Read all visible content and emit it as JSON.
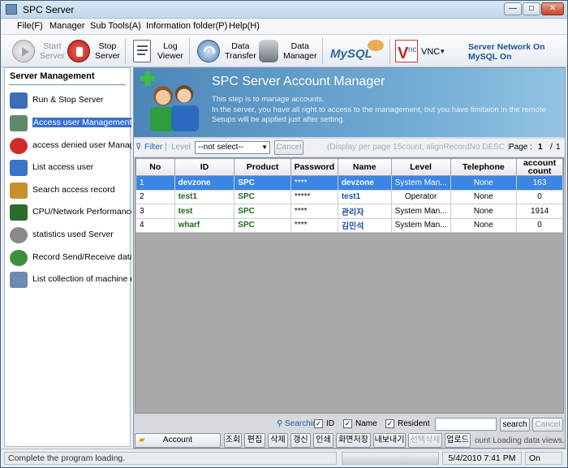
{
  "window": {
    "title": "SPC Server",
    "btn_min": "—",
    "btn_max": "□",
    "btn_close": "✕"
  },
  "menu": [
    "File(F)",
    "Manager",
    "Sub Tools(A)",
    "Information folder(P)",
    "Help(H)"
  ],
  "toolbar": {
    "start": "Start\nServer",
    "stop": "Stop\nServer",
    "log": "Log\nViewer",
    "transfer": "Data\nTransfer",
    "datamgr": "Data\nManager",
    "mysql": "MySQL",
    "vnc": "VNC",
    "vnc_arrow": "▾",
    "network_status": "Server Network On",
    "mysql_status": "MySQL On"
  },
  "sidebar": {
    "title": "Server Management",
    "items": [
      {
        "label": "Run & Stop Server",
        "icon": "server-run-icon",
        "color": "#3b6fb6"
      },
      {
        "label": "Access user Management",
        "icon": "users-icon",
        "color": "#5f8a6a"
      },
      {
        "label": "access denied user Management",
        "icon": "deny-icon",
        "color": "#cf2b2b"
      },
      {
        "label": "List access user",
        "icon": "user-list-icon",
        "color": "#3b74c8"
      },
      {
        "label": "Search access record",
        "icon": "search-record-icon",
        "color": "#c7902f"
      },
      {
        "label": "CPU/Network Performance",
        "icon": "performance-icon",
        "color": "#2d6b2d"
      },
      {
        "label": "statistics used Server",
        "icon": "statistics-icon",
        "color": "#8a8a8a"
      },
      {
        "label": "Record Send/Receive data",
        "icon": "send-receive-icon",
        "color": "#3f8f3a"
      },
      {
        "label": "List collection of machine data",
        "icon": "machine-data-icon",
        "color": "#6b8bb0"
      }
    ]
  },
  "banner": {
    "title": "SPC Server Account Manager",
    "line1": "This step is to manage accounts.",
    "line2": "In the server, you have all right to access to the management, but you have limitaion in the remote",
    "line3": "Setups will be applied just after setting."
  },
  "filter": {
    "filter_label": "Filter",
    "sep": "|",
    "level_label": "Level",
    "select_value": "--not select--",
    "cancel": "Cancel",
    "display_info": "(Display per page 15count, alignRecordNo DESC )",
    "page_label": "Page :",
    "page_current": "1",
    "page_sep": "/",
    "page_total": "1"
  },
  "table": {
    "headers": [
      "No",
      "ID",
      "Product",
      "Password",
      "Name",
      "Level",
      "Telephone",
      "account count"
    ],
    "rows": [
      [
        "1",
        "devzone",
        "SPC",
        "****",
        "devzone",
        "System Man...",
        "None",
        "163"
      ],
      [
        "2",
        "test1",
        "SPC",
        "*****",
        "test1",
        "Operator",
        "None",
        "0"
      ],
      [
        "3",
        "test",
        "SPC",
        "****",
        "관리자",
        "System Man...",
        "None",
        "1914"
      ],
      [
        "4",
        "wharf",
        "SPC",
        "****",
        "김민석",
        "System Man...",
        "None",
        "0"
      ]
    ],
    "selected_row": 0
  },
  "search": {
    "label": "Searchin",
    "id": "ID",
    "name": "Name",
    "resident": "Resident",
    "value": "",
    "search_btn": "search",
    "cancel_btn": "Cancel",
    "check": "✓"
  },
  "actions": {
    "account": "Account",
    "b1": "조회",
    "b2": "편집",
    "b3": "삭제",
    "b4": "갱신",
    "b5": "인쇄",
    "b6": "화면저장",
    "b7": "내보내기",
    "b8": "선택삭제",
    "b9": "업로드",
    "info": "ount Loading data views."
  },
  "status": {
    "message": "Complete the program loading.",
    "datetime": "5/4/2010 7:41 PM",
    "state": "On"
  }
}
